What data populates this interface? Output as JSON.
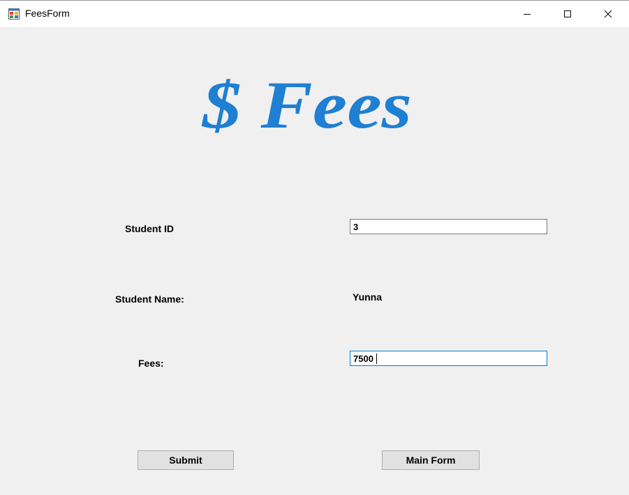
{
  "window": {
    "title": "FeesForm"
  },
  "window_controls": {
    "minimize_icon": "minimize-icon",
    "maximize_icon": "maximize-icon",
    "close_icon": "close-icon"
  },
  "form": {
    "heading": "$ Fees",
    "heading_color": "#1e7fd3",
    "student_id_label": "Student ID",
    "student_id_value": "3",
    "student_name_label": "Student Name:",
    "student_name_value": "Yunna",
    "fees_label": "Fees:",
    "fees_value": "7500"
  },
  "buttons": {
    "submit_label": "Submit",
    "main_form_label": "Main Form"
  }
}
